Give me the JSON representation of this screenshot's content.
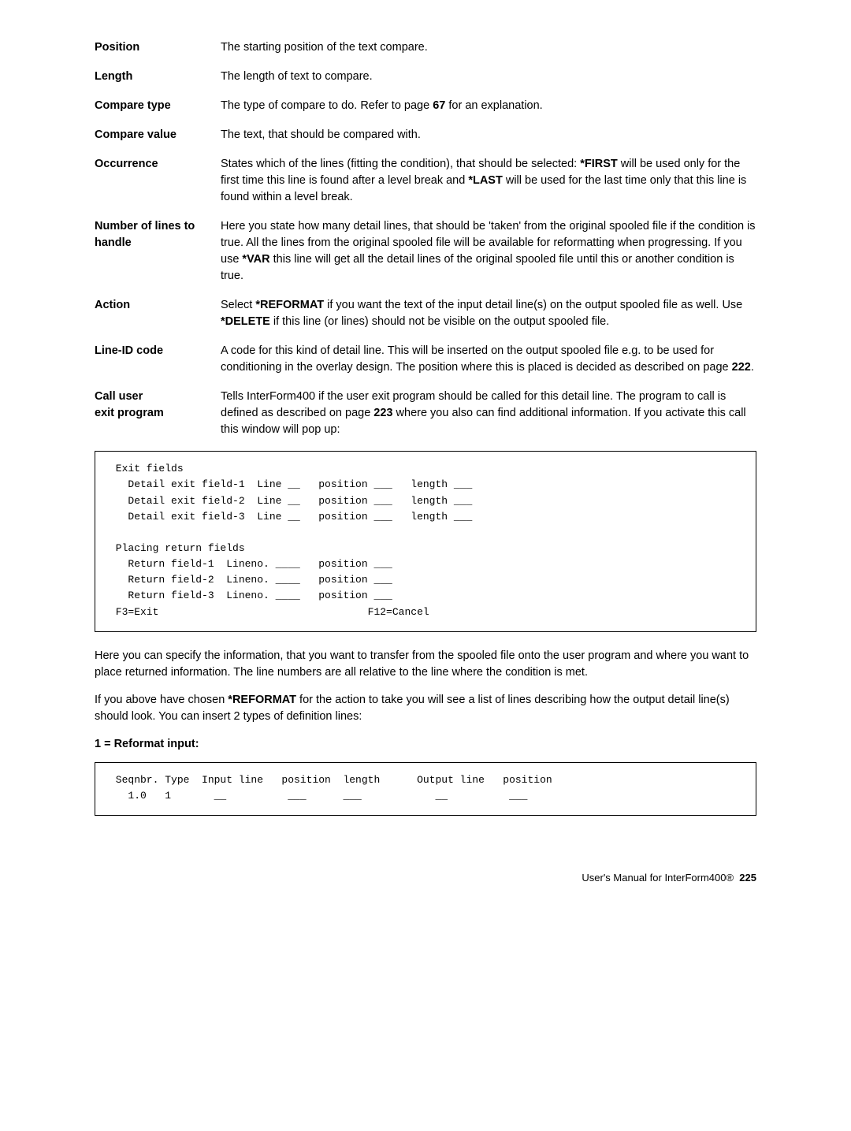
{
  "defs": [
    {
      "term": "Position",
      "body": "The starting position of the text compare."
    },
    {
      "term": "Length",
      "body": "The length of text to compare."
    },
    {
      "term": "Compare type",
      "body_html": "The type of compare to do. Refer to page <b>67</b> for an explanation."
    },
    {
      "term": "Compare value",
      "body": "The text, that should be compared with."
    },
    {
      "term": "Occurrence",
      "body_html": "States which of the lines (fitting the condition), that should be selected: <b>*FIRST</b> will be used only for the first time this line is found after a level break and <b>*LAST</b> will be used for the last time only that this line is found within a level break."
    },
    {
      "term": "Number of lines to handle",
      "body_html": "Here you state how many detail lines, that should be 'taken' from the original spooled file if the condition is true. All the lines from the original spooled file will be available for reformatting when progressing. If you use <b>*VAR</b> this line will get all the detail lines of the original spooled file until this or another condition is true."
    },
    {
      "term": "Action",
      "body_html": "Select <b>*REFORMAT</b> if you want the text of the input detail line(s) on the output spooled file as well. Use <b>*DELETE</b> if this line (or lines) should not be visible on the output spooled file."
    },
    {
      "term": "Line-ID code",
      "body_html": "A code for this kind of detail line. This will be inserted on the output spooled file e.g. to be used for conditioning in the overlay design. The position where this is placed is decided as described on page <b>222</b>."
    },
    {
      "term": "Call user\nexit program",
      "body_html": "Tells InterForm400 if the user exit program should be called for this detail line. The program to call is defined as described on page <b>223</b> where you also can find additional information. If you activate this call this window will pop up:"
    }
  ],
  "code1": " Exit fields\n   Detail exit field-1  Line __   position ___   length ___\n   Detail exit field-2  Line __   position ___   length ___\n   Detail exit field-3  Line __   position ___   length ___\n\n Placing return fields\n   Return field-1  Lineno. ____   position ___\n   Return field-2  Lineno. ____   position ___\n   Return field-3  Lineno. ____   position ___\n F3=Exit                                  F12=Cancel",
  "para1_html": "Here you can specify the information, that you want to transfer from the spooled file onto the user program and where you want to place returned information. The line numbers are all relative to the line where the condition is met.",
  "para2_html": "If you above have chosen <b>*REFORMAT</b> for the action to take you will see a list of lines describing how the output detail line(s) should look. You can insert 2 types of definition lines:",
  "section1": "1 = Reformat input:",
  "code2": " Seqnbr. Type  Input line   position  length      Output line   position\n   1.0   1       __          ___      ___            __          ___",
  "footer_html": "User's Manual for InterForm400®&nbsp;&nbsp;<b>225</b>"
}
